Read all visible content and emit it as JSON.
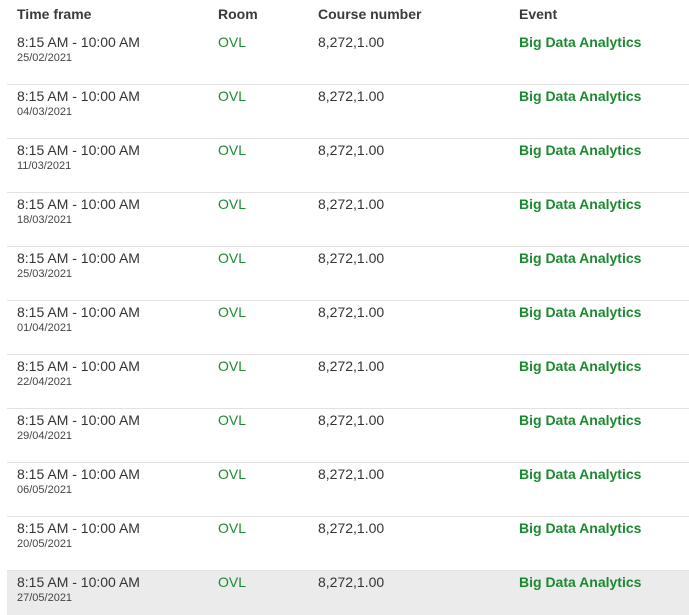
{
  "table": {
    "headers": {
      "time_frame": "Time frame",
      "room": "Room",
      "course_number": "Course number",
      "event": "Event"
    },
    "rows": [
      {
        "time": "8:15 AM - 10:00 AM",
        "date": "25/02/2021",
        "room": "OVL",
        "course": "8,272,1.00",
        "event": "Big Data Analytics"
      },
      {
        "time": "8:15 AM - 10:00 AM",
        "date": "04/03/2021",
        "room": "OVL",
        "course": "8,272,1.00",
        "event": "Big Data Analytics"
      },
      {
        "time": "8:15 AM - 10:00 AM",
        "date": "11/03/2021",
        "room": "OVL",
        "course": "8,272,1.00",
        "event": "Big Data Analytics"
      },
      {
        "time": "8:15 AM - 10:00 AM",
        "date": "18/03/2021",
        "room": "OVL",
        "course": "8,272,1.00",
        "event": "Big Data Analytics"
      },
      {
        "time": "8:15 AM - 10:00 AM",
        "date": "25/03/2021",
        "room": "OVL",
        "course": "8,272,1.00",
        "event": "Big Data Analytics"
      },
      {
        "time": "8:15 AM - 10:00 AM",
        "date": "01/04/2021",
        "room": "OVL",
        "course": "8,272,1.00",
        "event": "Big Data Analytics"
      },
      {
        "time": "8:15 AM - 10:00 AM",
        "date": "22/04/2021",
        "room": "OVL",
        "course": "8,272,1.00",
        "event": "Big Data Analytics"
      },
      {
        "time": "8:15 AM - 10:00 AM",
        "date": "29/04/2021",
        "room": "OVL",
        "course": "8,272,1.00",
        "event": "Big Data Analytics"
      },
      {
        "time": "8:15 AM - 10:00 AM",
        "date": "06/05/2021",
        "room": "OVL",
        "course": "8,272,1.00",
        "event": "Big Data Analytics"
      },
      {
        "time": "8:15 AM - 10:00 AM",
        "date": "20/05/2021",
        "room": "OVL",
        "course": "8,272,1.00",
        "event": "Big Data Analytics"
      },
      {
        "time": "8:15 AM - 10:00 AM",
        "date": "27/05/2021",
        "room": "OVL",
        "course": "8,272,1.00",
        "event": "Big Data Analytics"
      }
    ]
  },
  "colors": {
    "accent_green": "#1a8a2e",
    "hover_row": "#ebebeb",
    "divider": "#e2e2e2"
  }
}
